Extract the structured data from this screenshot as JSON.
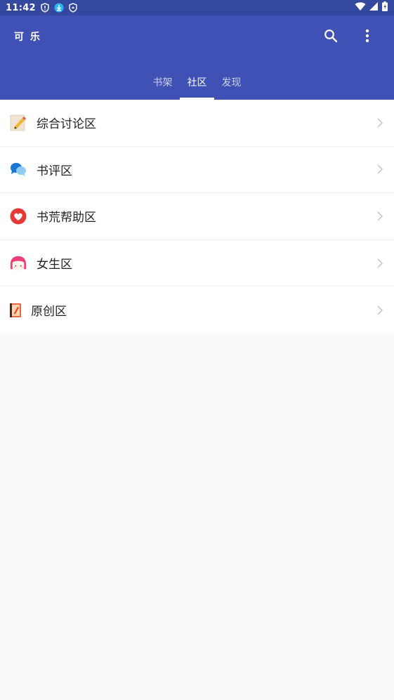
{
  "status_bar": {
    "time": "11:42"
  },
  "app_bar": {
    "title": "可 乐"
  },
  "tabs": [
    {
      "label": "书架",
      "active": false
    },
    {
      "label": "社区",
      "active": true
    },
    {
      "label": "发现",
      "active": false
    }
  ],
  "community_list": [
    {
      "label": "综合讨论区",
      "icon": "notepad-pencil-icon"
    },
    {
      "label": "书评区",
      "icon": "chat-bubbles-icon"
    },
    {
      "label": "书荒帮助区",
      "icon": "heart-icon"
    },
    {
      "label": "女生区",
      "icon": "girl-face-icon"
    },
    {
      "label": "原创区",
      "icon": "book-icon"
    }
  ],
  "colors": {
    "status_bar": "#3448a0",
    "app_bar": "#3f51b5",
    "background": "#fafafa"
  }
}
